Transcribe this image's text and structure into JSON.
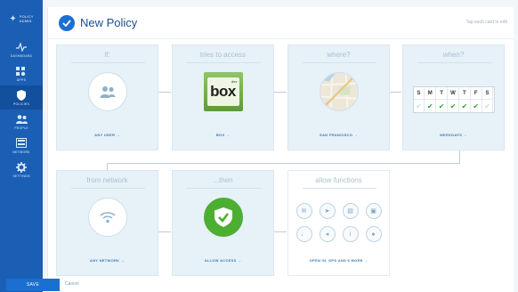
{
  "sidebar": {
    "brand": {
      "line1": "POLICY",
      "line2": "ADMIN"
    },
    "items": [
      {
        "label": "DASHBOARD",
        "icon": "pulse-icon"
      },
      {
        "label": "APPS",
        "icon": "apps-icon"
      },
      {
        "label": "POLICIES",
        "icon": "shield-icon"
      },
      {
        "label": "PEOPLE",
        "icon": "people-icon"
      },
      {
        "label": "NETWORK",
        "icon": "network-icon"
      },
      {
        "label": "SETTINGS",
        "icon": "gear-icon"
      }
    ]
  },
  "header": {
    "title": "New Policy",
    "note": "Tap each card to edit"
  },
  "cards": [
    {
      "title": "if:",
      "footer": "ANY USER →",
      "icon": "user-group-icon"
    },
    {
      "title": "tries to access",
      "footer": "BOX →",
      "icon": "box-logo"
    },
    {
      "title": "where?",
      "footer": "SAN FRANCISCO →",
      "icon": "map-pin-icon"
    },
    {
      "title": "when?",
      "footer": "WEEKDAYS →",
      "icon": "calendar-icon"
    },
    {
      "title": "from network",
      "footer": "ANY NETWORK →",
      "icon": "wifi-icon"
    },
    {
      "title": "...then",
      "footer": "ALLOW ACCESS →",
      "icon": "shield-check-icon"
    },
    {
      "title": "allow functions",
      "footer": "OPEN IN, GPS AND 6 MORE →",
      "icon": "functions-grid"
    }
  ],
  "box": {
    "word": "box",
    "sup": "dev"
  },
  "calendar": {
    "days": [
      "S",
      "M",
      "T",
      "W",
      "T",
      "F",
      "S"
    ],
    "checked": [
      false,
      true,
      true,
      true,
      true,
      true,
      false
    ]
  },
  "functions": [
    {
      "name": "mail-icon",
      "glyph": "✉"
    },
    {
      "name": "location-icon",
      "glyph": "➤"
    },
    {
      "name": "clipboard-icon",
      "glyph": "▤"
    },
    {
      "name": "camera-icon",
      "glyph": "▣"
    },
    {
      "name": "microphone-icon",
      "glyph": "♩"
    },
    {
      "name": "volume-icon",
      "glyph": "◂"
    },
    {
      "name": "info-icon",
      "glyph": "i"
    },
    {
      "name": "chat-icon",
      "glyph": "●"
    }
  ],
  "footer": {
    "save": "SAVE",
    "cancel": "Cancel"
  },
  "colors": {
    "sidebar": "#1a5fb4",
    "accent": "#1a6fd0",
    "allow": "#4caf32",
    "card": "#e7f1f8"
  }
}
